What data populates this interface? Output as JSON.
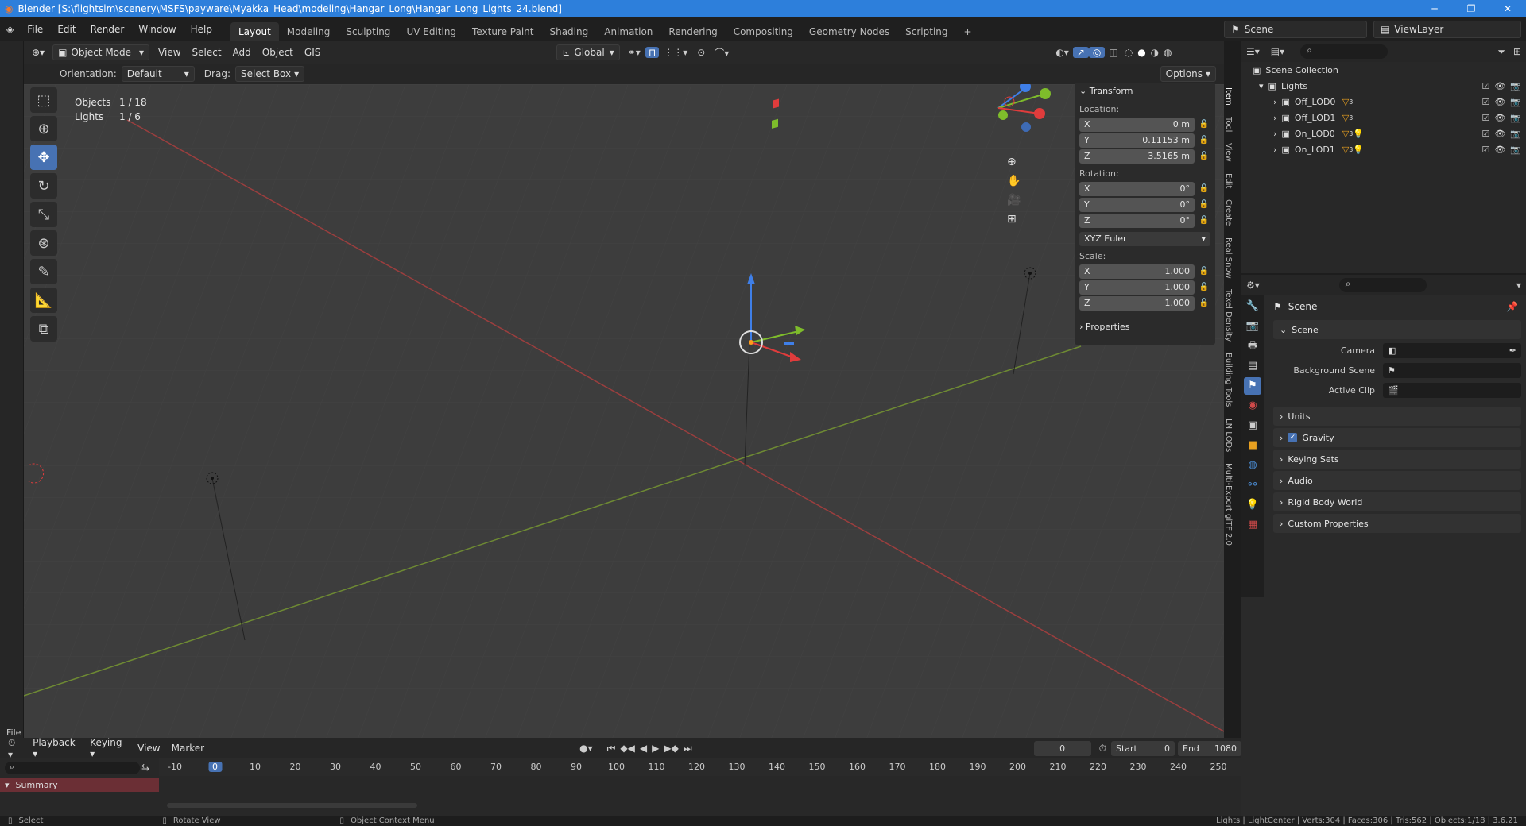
{
  "window": {
    "title": "Blender [S:\\flightsim\\scenery\\MSFS\\payware\\Myakka_Head\\modeling\\Hangar_Long\\Hangar_Long_Lights_24.blend]",
    "minimize": "─",
    "restore": "❐",
    "close": "✕"
  },
  "menus": [
    "File",
    "Edit",
    "Render",
    "Window",
    "Help"
  ],
  "workspaces": [
    "Layout",
    "Modeling",
    "Sculpting",
    "UV Editing",
    "Texture Paint",
    "Shading",
    "Animation",
    "Rendering",
    "Compositing",
    "Geometry Nodes",
    "Scripting",
    "+"
  ],
  "scene": {
    "label": "Scene",
    "view_layer": "ViewLayer"
  },
  "header3d": {
    "mode": "Object Mode",
    "menus": [
      "View",
      "Select",
      "Add",
      "Object",
      "GIS"
    ],
    "transform_space": "Global"
  },
  "toolheader": {
    "orientation_label": "Orientation:",
    "orientation_value": "Default",
    "drag_label": "Drag:",
    "drag_value": "Select Box",
    "options": "Options"
  },
  "objinfo": {
    "objects_label": "Objects",
    "objects_value": "1 / 18",
    "lights_label": "Lights",
    "lights_value": "1 / 6"
  },
  "npanel": {
    "transform_title": "Transform",
    "location_label": "Location:",
    "location": [
      {
        "axis": "X",
        "value": "0 m"
      },
      {
        "axis": "Y",
        "value": "0.11153 m"
      },
      {
        "axis": "Z",
        "value": "3.5165 m"
      }
    ],
    "rotation_label": "Rotation:",
    "rotation": [
      {
        "axis": "X",
        "value": "0°"
      },
      {
        "axis": "Y",
        "value": "0°"
      },
      {
        "axis": "Z",
        "value": "0°"
      }
    ],
    "rotation_mode": "XYZ Euler",
    "scale_label": "Scale:",
    "scale": [
      {
        "axis": "X",
        "value": "1.000"
      },
      {
        "axis": "Y",
        "value": "1.000"
      },
      {
        "axis": "Z",
        "value": "1.000"
      }
    ],
    "properties_title": "Properties"
  },
  "ntabs": [
    "Item",
    "Tool",
    "View",
    "Edit",
    "Create",
    "Real Snow",
    "Texel Density",
    "Building Tools",
    "LN LODs",
    "Multi-Export glTF 2.0"
  ],
  "outliner": {
    "root": "Scene Collection",
    "collection": "Lights",
    "items": [
      {
        "name": "Off_LOD0",
        "count": "3"
      },
      {
        "name": "Off_LOD1",
        "count": "3"
      },
      {
        "name": "On_LOD0",
        "count": "3"
      },
      {
        "name": "On_LOD1",
        "count": "3"
      }
    ]
  },
  "properties": {
    "context": "Scene",
    "section": "Scene",
    "camera_label": "Camera",
    "camera_value": "",
    "background_scene_label": "Background Scene",
    "background_scene_value": "",
    "active_clip_label": "Active Clip",
    "active_clip_value": "",
    "subsections": [
      "Units",
      "Gravity",
      "Keying Sets",
      "Audio",
      "Rigid Body World",
      "Custom Properties"
    ]
  },
  "timeline": {
    "menus": [
      "Playback",
      "Keying",
      "View",
      "Marker"
    ],
    "current_frame": "0",
    "start_label": "Start",
    "start": "0",
    "end_label": "End",
    "end": "1080",
    "ruler": [
      "-10",
      "0",
      "10",
      "20",
      "30",
      "40",
      "50",
      "60",
      "70",
      "80",
      "90",
      "100",
      "110",
      "120",
      "130",
      "140",
      "150",
      "160",
      "170",
      "180",
      "190",
      "200",
      "210",
      "220",
      "230",
      "240",
      "250"
    ],
    "summary": "Summary",
    "file_label": "File"
  },
  "statusbar": {
    "left": "Select",
    "mid": "Rotate View",
    "right": "Object Context Menu",
    "info": "Lights | LightCenter | Verts:304 | Faces:306 | Tris:562 | Objects:1/18 | 3.6.21"
  },
  "colors": {
    "accent": "#4772b3",
    "title_bar": "#2d7fdb",
    "x_axis": "#e03c3c",
    "y_axis": "#7ebc2b",
    "z_axis": "#3f7fe8"
  }
}
